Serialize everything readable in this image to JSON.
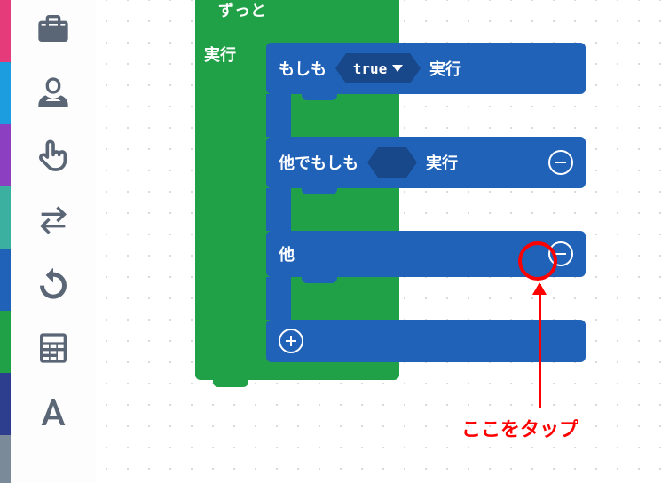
{
  "sidebar": {
    "items": [
      {
        "name": "toolbox-icon"
      },
      {
        "name": "astronaut-icon"
      },
      {
        "name": "pointer-icon"
      },
      {
        "name": "swap-icon"
      },
      {
        "name": "undo-icon"
      },
      {
        "name": "calculator-icon"
      },
      {
        "name": "text-icon"
      }
    ]
  },
  "loop": {
    "header_label": "ずっと",
    "exec_label": "実行"
  },
  "ifblock": {
    "if_label": "もしも",
    "value": "true",
    "exec_label": "実行",
    "elseif_label": "他でもしも",
    "elseif_exec": "実行",
    "else_label": "他"
  },
  "annotation": {
    "text": "ここをタップ"
  },
  "colors": {
    "green": "#21a147",
    "blue": "#2062b8",
    "darkblue": "#18488a",
    "red": "#ff0000"
  }
}
